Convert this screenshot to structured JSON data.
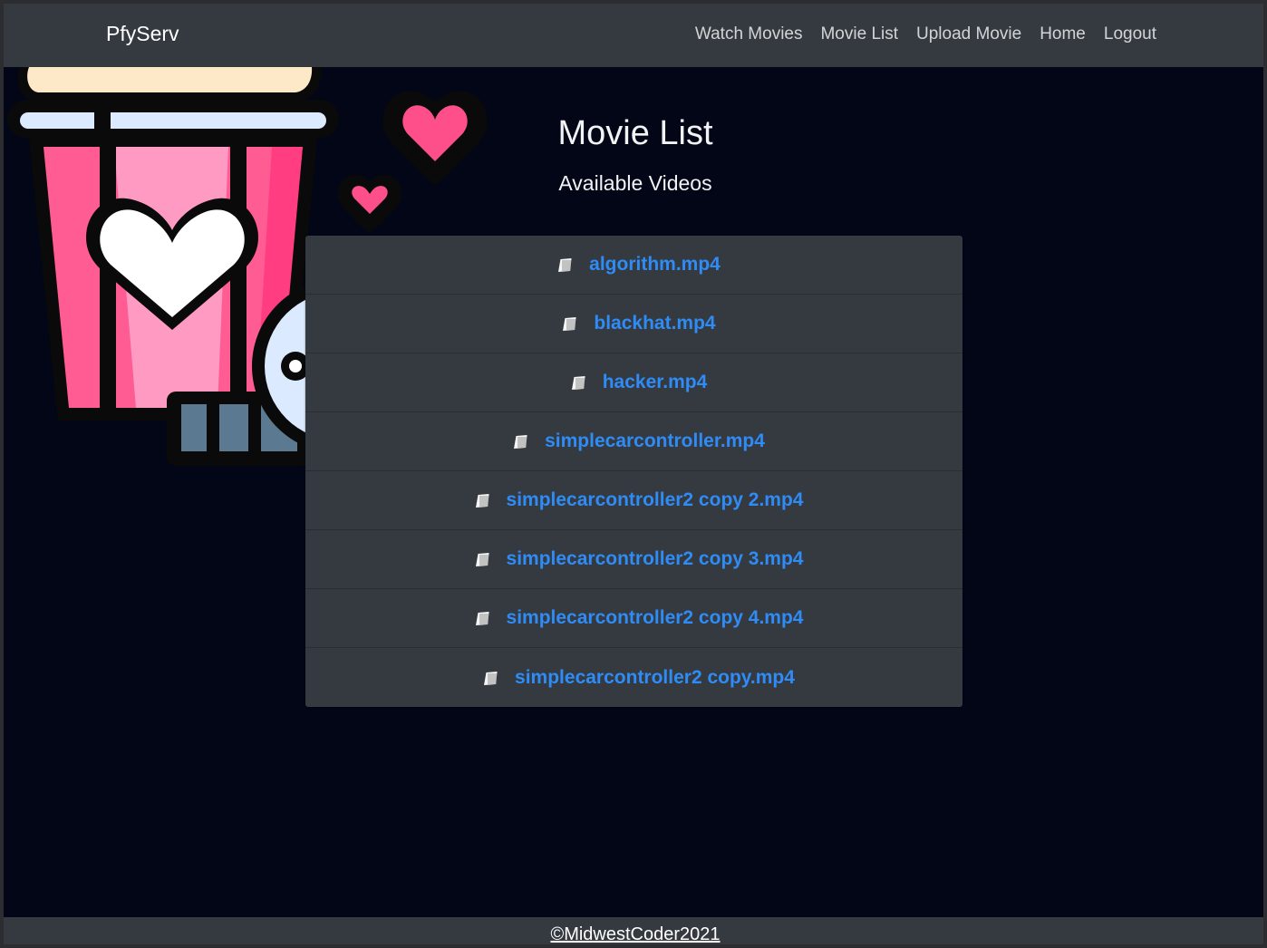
{
  "navbar": {
    "brand": "PfyServ",
    "links": [
      {
        "label": "Watch Movies"
      },
      {
        "label": "Movie List"
      },
      {
        "label": "Upload Movie"
      },
      {
        "label": "Home"
      },
      {
        "label": "Logout"
      }
    ]
  },
  "main": {
    "title": "Movie List",
    "subtitle": "Available Videos",
    "videos": [
      {
        "name": "algorithm.mp4",
        "icon": "file-icon"
      },
      {
        "name": "blackhat.mp4",
        "icon": "file-icon"
      },
      {
        "name": "hacker.mp4",
        "icon": "file-icon"
      },
      {
        "name": "simplecarcontroller.mp4",
        "icon": "file-icon"
      },
      {
        "name": "simplecarcontroller2 copy 2.mp4",
        "icon": "file-icon"
      },
      {
        "name": "simplecarcontroller2 copy 3.mp4",
        "icon": "file-icon"
      },
      {
        "name": "simplecarcontroller2 copy 4.mp4",
        "icon": "file-icon"
      },
      {
        "name": "simplecarcontroller2 copy.mp4",
        "icon": "file-icon"
      }
    ]
  },
  "footer": {
    "text": "©MidwestCoder2021"
  },
  "colors": {
    "background": "#020617",
    "navbar": "#343a40",
    "link": "#2f8cf6",
    "popcorn_pink": "#ff5c93",
    "popcorn_light_pink": "#ff9ac2",
    "heart": "#ff4f8b"
  }
}
